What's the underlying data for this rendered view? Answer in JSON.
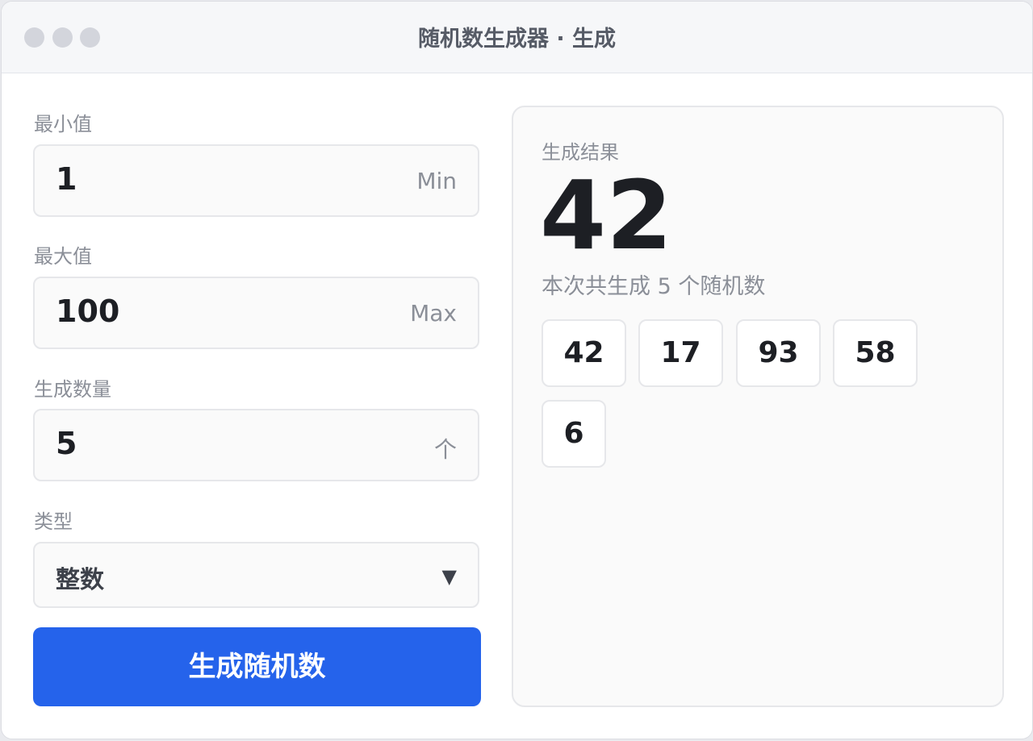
{
  "window": {
    "title": "随机数生成器 · 生成"
  },
  "form": {
    "min": {
      "label": "最小值",
      "value": "1",
      "suffix": "Min"
    },
    "max": {
      "label": "最大值",
      "value": "100",
      "suffix": "Max"
    },
    "count": {
      "label": "生成数量",
      "value": "5",
      "suffix": "个"
    },
    "type": {
      "label": "类型",
      "value": "整数",
      "caret": "▼"
    },
    "generate_label": "生成随机数"
  },
  "result": {
    "label": "生成结果",
    "main_value": "42",
    "summary": "本次共生成 5 个随机数",
    "numbers": [
      "42",
      "17",
      "93",
      "58",
      "6"
    ]
  },
  "colors": {
    "accent": "#2563eb",
    "window_dot": "#d3d5dc",
    "text_primary": "#1d1f24",
    "text_muted": "#8b8f98"
  }
}
